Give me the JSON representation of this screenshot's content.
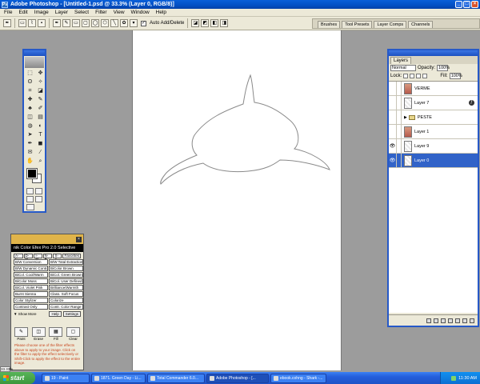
{
  "window": {
    "title": "Adobe Photoshop - [Untitled-1.psd @ 33.3% (Layer 0, RGB/8)]",
    "app_icon": "Ps"
  },
  "menu": [
    "File",
    "Edit",
    "Image",
    "Layer",
    "Select",
    "Filter",
    "View",
    "Window",
    "Help"
  ],
  "options_bar": {
    "auto_add_delete_label": "Auto Add/Delete",
    "auto_add_delete_checked": true,
    "palette_well_tabs": [
      "Brushes",
      "Tool Presets",
      "Layer Comps",
      "Channels"
    ]
  },
  "tools": {
    "icons": [
      "rect-marquee-icon",
      "move-icon",
      "lasso-icon",
      "magic-wand-icon",
      "crop-icon",
      "slice-icon",
      "healing-brush-icon",
      "brush-icon",
      "clone-stamp-icon",
      "history-brush-icon",
      "eraser-icon",
      "gradient-icon",
      "blur-icon",
      "dodge-icon",
      "path-select-icon",
      "type-icon",
      "pen-icon",
      "custom-shape-icon",
      "notes-icon",
      "eyedropper-icon",
      "hand-icon",
      "zoom-icon"
    ],
    "glyphs": [
      "⬚",
      "✥",
      "ʘ",
      "✧",
      "⌗",
      "◪",
      "✚",
      "✎",
      "♣",
      "✐",
      "◫",
      "▤",
      "◍",
      "◐",
      "➤",
      "T",
      "✒",
      "◼",
      "✉",
      "⁄",
      "✋",
      "⌕"
    ],
    "foreground_color": "#000000",
    "background_color": "#ffffff"
  },
  "layers_panel": {
    "tab": "Layers",
    "blend_mode": "Normal",
    "opacity_label": "Opacity:",
    "opacity_value": "100%",
    "lock_label": "Lock:",
    "fill_label": "Fill:",
    "fill_value": "100%",
    "layers": [
      {
        "name": "VERME",
        "visible": false,
        "kind": "photo",
        "active": false,
        "fx": false
      },
      {
        "name": "Layer 7",
        "visible": false,
        "kind": "shape",
        "active": false,
        "fx": true
      },
      {
        "name": "PESTE",
        "visible": false,
        "kind": "folder",
        "active": false,
        "fx": false
      },
      {
        "name": "Layer 1",
        "visible": false,
        "kind": "photo",
        "active": false,
        "fx": false
      },
      {
        "name": "Layer 9",
        "visible": true,
        "kind": "shape",
        "active": false,
        "fx": false
      },
      {
        "name": "Layer 0",
        "visible": true,
        "kind": "shape",
        "active": true,
        "fx": false
      }
    ],
    "bottom_icons": [
      "link-icon",
      "style-icon",
      "mask-icon",
      "set-icon",
      "adjustment-icon",
      "new-layer-icon",
      "trash-icon"
    ]
  },
  "nik_panel": {
    "title": "nik Color Efex Pro 2.0 Selective",
    "tabs": [
      "A-C",
      "D-H",
      "I-M",
      "N-R",
      "S-Z",
      "Favorites"
    ],
    "filters": [
      "B/W Conversion",
      "B/W Total Extraction",
      "B/W Dynamic Contrast",
      "BiColor Brown",
      "BiCol. Cool/Warm",
      "BiCol. Green Brown",
      "BiColor Moss",
      "BiCol. User Defined",
      "BiCol. Violet Pink",
      "Brilliance/Warmth",
      "Burnt Sienna",
      "Class. Soft Focus",
      "Color Stylizer",
      "Colorize",
      "Contrast Only",
      "Contr. Color Range"
    ],
    "show_more": "Show More",
    "help": "Help",
    "settings": "Settings",
    "actions": [
      "Paint",
      "Erase",
      "Fill",
      "Clear"
    ],
    "help_text": "Please choose one of the filter effects above to apply to your image. Click on the filter to apply the effect selectively or Shift-Click to apply the effect to the entire image."
  },
  "zoom_field": "33.33%",
  "taskbar": {
    "start": "start",
    "tasks": [
      {
        "label": "19 - Paint",
        "active": false
      },
      {
        "label": "1871. Green Day - Li...",
        "active": false
      },
      {
        "label": "Total Commander 6.0...",
        "active": false
      },
      {
        "label": "Adobe Photoshop - [...",
        "active": true
      },
      {
        "label": "ebook.cohng - Shark -...",
        "active": false
      }
    ],
    "clock": "11:30 AM"
  },
  "colors": {
    "xp_blue": "#245edb",
    "selection": "#3163c8",
    "nik_header": "#e0b44a"
  }
}
